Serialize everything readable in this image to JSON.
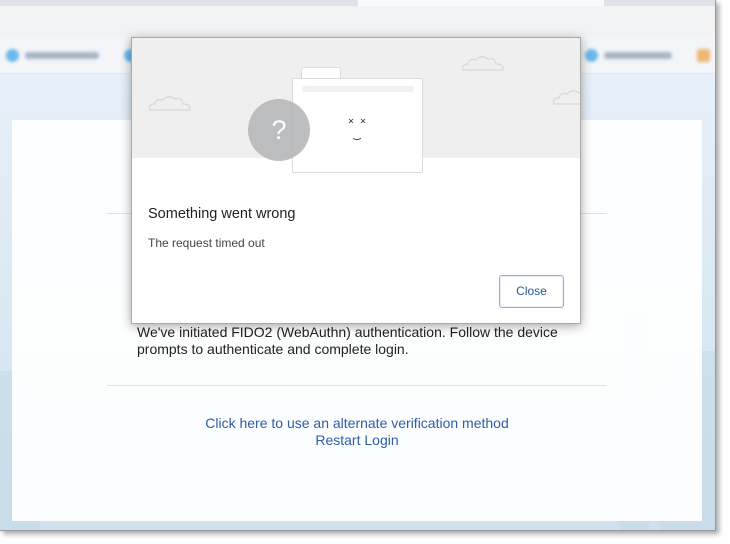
{
  "dialog": {
    "title": "Something went wrong",
    "message": "The request timed out",
    "close_label": "Close",
    "illustration": {
      "question_glyph": "?",
      "face_eyes": "×   ×",
      "face_mouth": "‿",
      "icons": [
        "question-circle-icon",
        "sad-browser-icon",
        "cloud-icon"
      ]
    }
  },
  "page": {
    "fido_message": "We've initiated FIDO2 (WebAuthn) authentication. Follow the device prompts to authenticate and complete login.",
    "alternate_link": "Click here to use an alternate verification method",
    "restart_link": "Restart Login"
  },
  "colors": {
    "link": "#2f5da8",
    "button_text": "#2a5699",
    "illustration_bg": "#efefef",
    "question_circle": "#b8b9bb"
  }
}
